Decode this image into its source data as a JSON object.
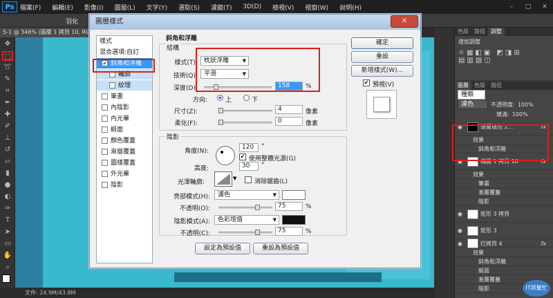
{
  "app": {
    "logo": "Ps",
    "menu": [
      "檔案(F)",
      "編輯(E)",
      "影像(I)",
      "圖層(L)",
      "文字(Y)",
      "選取(S)",
      "濾鏡(T)",
      "3D(D)",
      "檢視(V)",
      "視窗(W)",
      "說明(H)"
    ],
    "doc_tab": "5-1 @ 346% (圖層 1 拷貝 10, RGB",
    "status": "文件: 24.9M/43.8M",
    "option_partial": "羽化"
  },
  "right": {
    "tabs_top": [
      "色版",
      "路徑",
      "調整"
    ],
    "adjust_title": "增加調整",
    "layer_tabs": [
      "圖層",
      "色版",
      "路徑"
    ],
    "kind": "種類",
    "blend": "濾色",
    "opacity_label": "不透明度:",
    "opacity": "100%",
    "fill_label": "填滿:",
    "fill": "100%",
    "layers": [
      {
        "name": "漸層填色 2...",
        "fx": "fx",
        "kind": "big"
      },
      {
        "name": "效果",
        "kind": "sub"
      },
      {
        "name": "斜角和浮雕",
        "kind": "sub2"
      },
      {
        "name": "橢圓 1 拷貝 10",
        "fx": "fx",
        "kind": "big"
      },
      {
        "name": "效果",
        "kind": "sub"
      },
      {
        "name": "筆畫",
        "kind": "sub2"
      },
      {
        "name": "漸層覆蓋",
        "kind": "sub2"
      },
      {
        "name": "陰影",
        "kind": "sub2"
      },
      {
        "name": "矩形 3 拷貝",
        "fx": "",
        "kind": "big"
      },
      {
        "name": "矩形 3",
        "fx": "",
        "kind": "big"
      },
      {
        "name": "打拷貝 4",
        "fx": "fx",
        "kind": "norm"
      },
      {
        "name": "效果",
        "kind": "sub"
      },
      {
        "name": "斜角和浮雕",
        "kind": "sub2"
      },
      {
        "name": "緞面",
        "kind": "sub2"
      },
      {
        "name": "漸層覆蓋",
        "kind": "sub2"
      },
      {
        "name": "陰影",
        "kind": "sub2"
      }
    ],
    "watermark": "IT邦幫忙"
  },
  "dialog": {
    "title": "圖層樣式",
    "close": "✕",
    "list_header": "樣式",
    "list_header2": "混合選項:自訂",
    "items": [
      {
        "label": "斜角和浮雕",
        "checked": true,
        "state": "sel"
      },
      {
        "label": "輪廓",
        "checked": false,
        "state": "sub"
      },
      {
        "label": "紋理",
        "checked": false,
        "state": "sub"
      },
      {
        "label": "筆畫",
        "checked": false,
        "state": ""
      },
      {
        "label": "內陰影",
        "checked": false,
        "state": ""
      },
      {
        "label": "內光暈",
        "checked": false,
        "state": ""
      },
      {
        "label": "緞面",
        "checked": false,
        "state": ""
      },
      {
        "label": "顏色覆蓋",
        "checked": false,
        "state": ""
      },
      {
        "label": "漸層覆蓋",
        "checked": false,
        "state": ""
      },
      {
        "label": "圖樣覆蓋",
        "checked": false,
        "state": ""
      },
      {
        "label": "外光暈",
        "checked": false,
        "state": ""
      },
      {
        "label": "陰影",
        "checked": false,
        "state": ""
      }
    ],
    "section_title": "斜角和浮雕",
    "structure": "結構",
    "style_label": "樣式(T):",
    "style_value": "枕狀浮雕",
    "technique_label": "技術(Q):",
    "technique_value": "平滑",
    "depth_label": "深度(D):",
    "depth_value": "158",
    "depth_level": 0.15,
    "depth_unit": "%",
    "direction_label": "方向:",
    "dir_up": "上",
    "dir_down": "下",
    "size_label": "尺寸(Z):",
    "size_value": "4",
    "size_unit": "像素",
    "soften_label": "柔化(F):",
    "soften_value": "0",
    "soften_unit": "像素",
    "shading": "陰影",
    "angle_label": "角度(N):",
    "angle_value": "120",
    "deg": "°",
    "global_light": "使用整體光源(G)",
    "altitude_label": "高度:",
    "altitude_value": "30",
    "gloss_label": "光澤輪廓:",
    "antialias": "消除鋸齒(L)",
    "highlight_label": "亮部模式(H):",
    "highlight_mode": "濾色",
    "hl_opacity_label": "不透明(O):",
    "hl_opacity": "75",
    "pct": "%",
    "shadow_label": "陰影模式(A):",
    "shadow_mode": "色彩增值",
    "sh_opacity_label": "不透明(C):",
    "sh_opacity": "75",
    "make_default": "設定為預設值",
    "reset_default": "重設為預設值",
    "ok": "確定",
    "reset": "重設",
    "new_style": "新增樣式(W)...",
    "preview": "預視(V)"
  }
}
